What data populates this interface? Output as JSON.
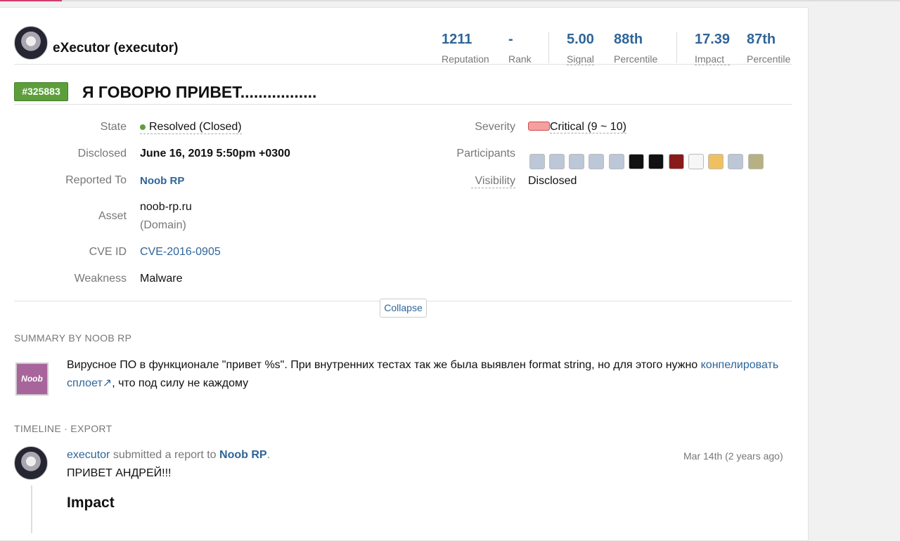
{
  "user": {
    "name": "eXecutor (executor)"
  },
  "stats": [
    {
      "value": "1211",
      "label": "Reputation"
    },
    {
      "value": "-",
      "label": "Rank"
    },
    {
      "value": "5.00",
      "label": "Signal"
    },
    {
      "value": "88th",
      "label": "Percentile"
    },
    {
      "value": "17.39",
      "label": "Impact"
    },
    {
      "value": "87th",
      "label": "Percentile"
    }
  ],
  "report": {
    "id": "#325883",
    "title": "Я ГОВОРЮ ПРИВЕТ.................",
    "state_label": "State",
    "state": "Resolved (Closed)",
    "disclosed_label": "Disclosed",
    "disclosed": "June 16, 2019 5:50pm +0300",
    "reported_to_label": "Reported To",
    "reported_to": "Noob RP",
    "asset_label": "Asset",
    "asset": "noob-rp.ru",
    "asset_type": "(Domain)",
    "cve_label": "CVE ID",
    "cve": "CVE-2016-0905",
    "weakness_label": "Weakness",
    "weakness": "Malware",
    "severity_label": "Severity",
    "severity": "Critical (9 ~ 10)",
    "participants_label": "Participants",
    "visibility_label": "Visibility",
    "visibility": "Disclosed",
    "collapse": "Collapse"
  },
  "summary": {
    "heading": "SUMMARY BY NOOB RP",
    "logo_text": "Noob",
    "text1": "Вирусное ПО в функционале \"привет %s\". При внутренних тестах так же была выявлен format string, но для этого нужно",
    "link": "конпелировать сплоет",
    "text2": ", что под силу не каждому"
  },
  "timeline": {
    "heading": "TIMELINE · EXPORT",
    "actor": "executor",
    "action": " submitted a report to ",
    "target": "Noob RP",
    "dot": ".",
    "time": "Mar 14th (2 years ago)",
    "body": "ПРИВЕТ АНДРЕЙ!!!",
    "subheading": "Impact"
  }
}
